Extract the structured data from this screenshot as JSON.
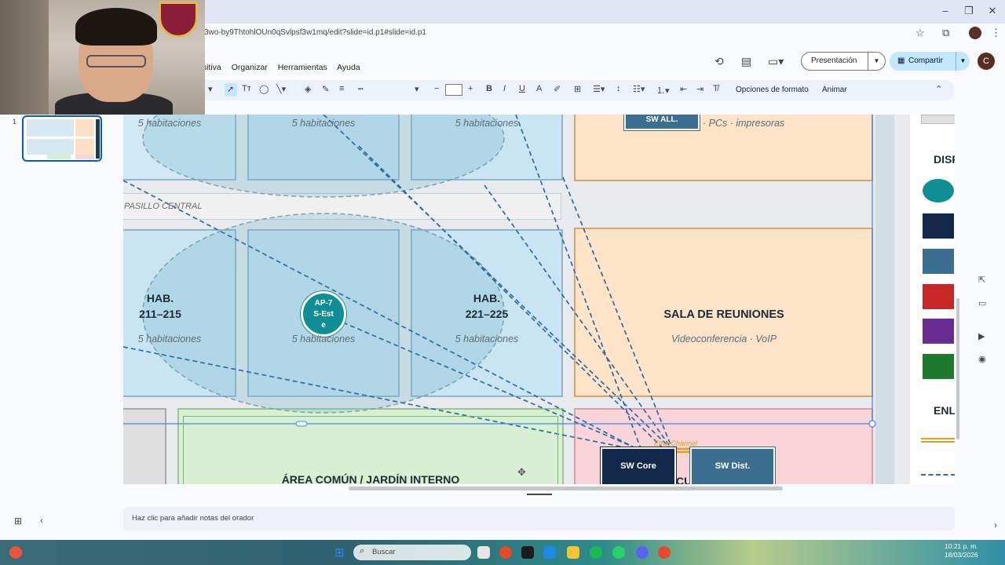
{
  "browser": {
    "url": "3wo-by9ThtohlOUn0qSvlpsf3w1mq/edit?slide=id.p1#slide=id.p1",
    "profile_initial": "C"
  },
  "menu": {
    "items": [
      "ositiva",
      "Organizar",
      "Herramientas",
      "Ayuda"
    ]
  },
  "header": {
    "presentation_button": "Presentación",
    "share_button": "Compartir",
    "avatar_initial": "C"
  },
  "toolbar": {
    "format_options": "Opciones de formato",
    "animate": "Animar",
    "bold": "B",
    "italic": "I",
    "underline": "U"
  },
  "sidebar": {
    "slide_number": "1"
  },
  "slide": {
    "top_notes": [
      "5 habitaciones",
      "5 habitaciones",
      "5 habitaciones"
    ],
    "sw_all_label": "SW ALL.",
    "pcs_note": "· PCs · impresoras",
    "corridor": "PASILLO CENTRAL",
    "room_left_title": "HAB.\n211–215",
    "room_left_line1": "HAB.",
    "room_left_line2": "211–215",
    "room_right_line1": "HAB.",
    "room_right_line2": "221–225",
    "ap_label_line1": "AP-7",
    "ap_label_line2": "S-Est",
    "ap_label_line3": "e",
    "mid_notes": [
      "5 habitaciones",
      "5 habitaciones",
      "5 habitaciones"
    ],
    "meeting_title": "SALA DE REUNIONES",
    "meeting_note": "Videoconferencia · VoIP",
    "common_area": "ÁREA COMÚN / JARDÍN INTERNO",
    "sw_core": "SW Core",
    "sw_dist": "SW Dist.",
    "ether_channel": "EtherChannel",
    "cu_fragment": "CU",
    "legend_title_1": "DISP",
    "legend_title_2": "ENL",
    "legend_colors": [
      "#0f8f94",
      "#13294b",
      "#3b6e8f",
      "#c62828",
      "#6a2c91",
      "#1e7a2e"
    ]
  },
  "notes": {
    "placeholder": "Haz clic para añadir notas del orador"
  },
  "taskbar": {
    "search_placeholder": "Buscar",
    "time": "10:21 p. m.",
    "date": "18/03/2026"
  }
}
